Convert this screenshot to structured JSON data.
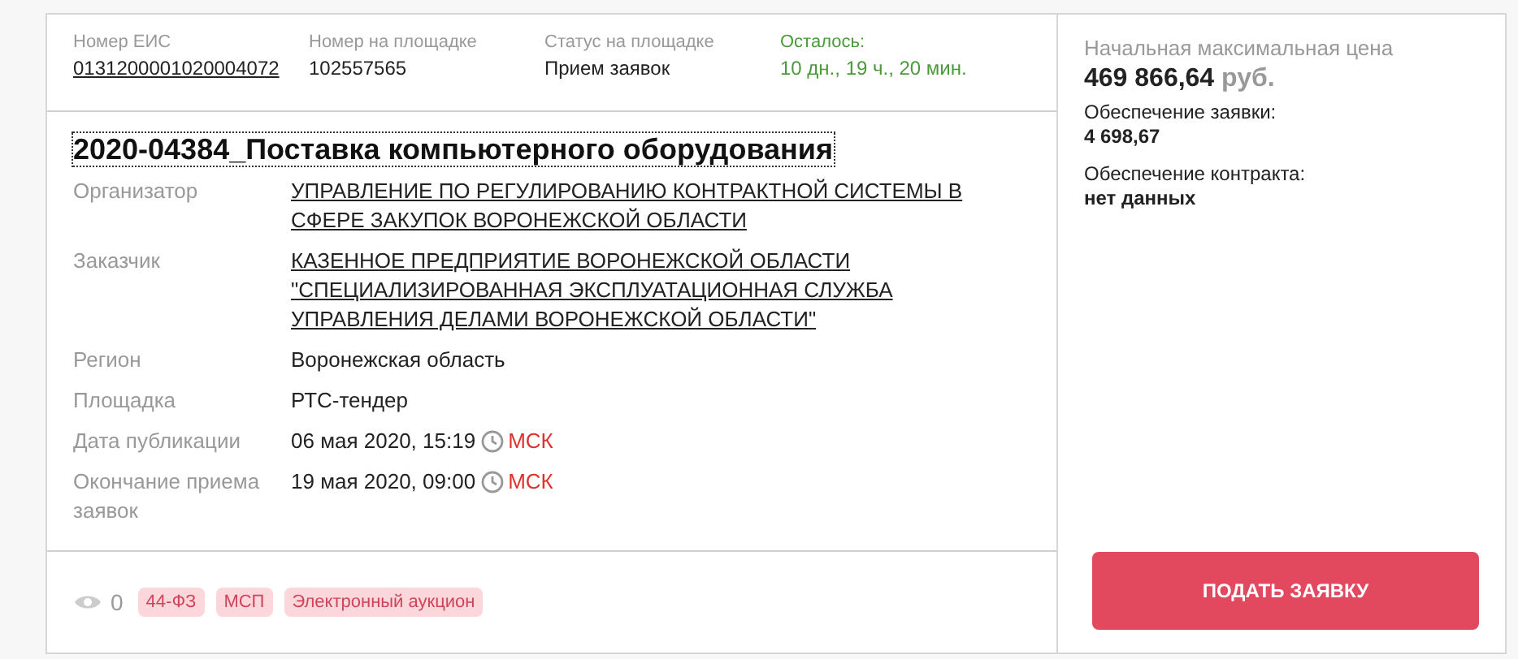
{
  "header": [
    {
      "label": "Номер ЕИС",
      "value": "0131200001020004072",
      "kind": "link"
    },
    {
      "label": "Номер на площадке",
      "value": "102557565",
      "kind": "text"
    },
    {
      "label": "Статус на площадке",
      "value": "Прием заявок",
      "kind": "text"
    },
    {
      "label": "Осталось:",
      "value": "10 дн., 19 ч., 20 мин.",
      "kind": "remaining"
    }
  ],
  "title": "2020-04384_Поставка компьютерного оборудования",
  "details": [
    {
      "label": "Организатор",
      "value": "УПРАВЛЕНИЕ ПО РЕГУЛИРОВАНИЮ КОНТРАКТНОЙ СИСТЕМЫ В СФЕРЕ ЗАКУПОК ВОРОНЕЖСКОЙ ОБЛАСТИ",
      "kind": "link"
    },
    {
      "label": "Заказчик",
      "value": "КАЗЕННОЕ ПРЕДПРИЯТИЕ ВОРОНЕЖСКОЙ ОБЛАСТИ \"СПЕЦИАЛИЗИРОВАННАЯ ЭКСПЛУАТАЦИОННАЯ СЛУЖБА УПРАВЛЕНИЯ ДЕЛАМИ ВОРОНЕЖСКОЙ ОБЛАСТИ\"",
      "kind": "link"
    },
    {
      "label": "Регион",
      "value": "Воронежская область",
      "kind": "text"
    },
    {
      "label": "Площадка",
      "value": "РТС-тендер",
      "kind": "text"
    },
    {
      "label": "Дата публикации",
      "value": "06 мая 2020, 15:19",
      "timezone": "МСК",
      "kind": "datetime"
    },
    {
      "label": "Окончание приема заявок",
      "value": "19 мая 2020, 09:00",
      "timezone": "МСК",
      "kind": "datetime"
    }
  ],
  "footer": {
    "views": "0",
    "tags": [
      "44-ФЗ",
      "МСП",
      "Электронный аукцион"
    ]
  },
  "price": {
    "label": "Начальная максимальная цена",
    "amount": "469 866,64",
    "currency": "руб."
  },
  "securities": [
    {
      "label": "Обеспечение заявки:",
      "value": "4 698,67"
    },
    {
      "label": "Обеспечение контракта:",
      "value": "нет данных"
    }
  ],
  "button": "ПОДАТЬ ЗАЯВКУ"
}
